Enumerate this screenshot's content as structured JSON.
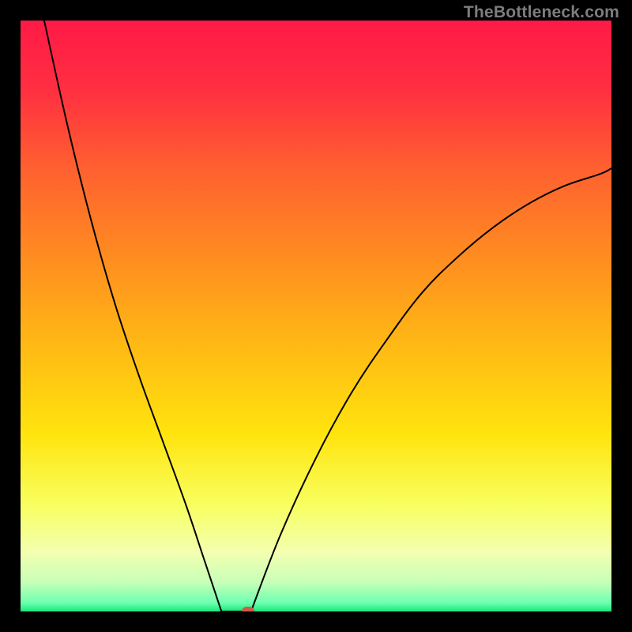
{
  "watermark": "TheBottleneck.com",
  "colors": {
    "frame": "#000000",
    "curve": "#000000",
    "dot": "#cf5b4b",
    "watermark_text": "#7d7d7d",
    "gradient_stops": [
      {
        "offset": 0.0,
        "color": "#ff1a47"
      },
      {
        "offset": 0.12,
        "color": "#ff3040"
      },
      {
        "offset": 0.25,
        "color": "#ff6030"
      },
      {
        "offset": 0.4,
        "color": "#ff8c20"
      },
      {
        "offset": 0.55,
        "color": "#ffb914"
      },
      {
        "offset": 0.7,
        "color": "#ffe40e"
      },
      {
        "offset": 0.82,
        "color": "#f8ff60"
      },
      {
        "offset": 0.9,
        "color": "#f3ffb0"
      },
      {
        "offset": 0.95,
        "color": "#c8ffb8"
      },
      {
        "offset": 0.985,
        "color": "#6fffb0"
      },
      {
        "offset": 1.0,
        "color": "#17e87a"
      }
    ]
  },
  "chart_data": {
    "type": "line",
    "title": "",
    "xlabel": "",
    "ylabel": "",
    "xlim": [
      0,
      100
    ],
    "ylim": [
      0,
      100
    ],
    "notch_x": 37,
    "flat_bottom": {
      "x_start": 34,
      "x_end": 39,
      "y": 0
    },
    "dot": {
      "x": 38.5,
      "y": 0
    },
    "series": [
      {
        "name": "left-branch",
        "x": [
          4,
          8,
          12,
          16,
          20,
          24,
          28,
          31,
          34
        ],
        "y": [
          100,
          82,
          66,
          52,
          40,
          29,
          18,
          9,
          0
        ]
      },
      {
        "name": "right-branch",
        "x": [
          39,
          44,
          50,
          56,
          62,
          68,
          74,
          80,
          86,
          92,
          98,
          100
        ],
        "y": [
          0,
          13,
          26,
          37,
          46,
          54,
          60,
          65,
          69,
          72,
          74,
          75
        ]
      }
    ]
  }
}
